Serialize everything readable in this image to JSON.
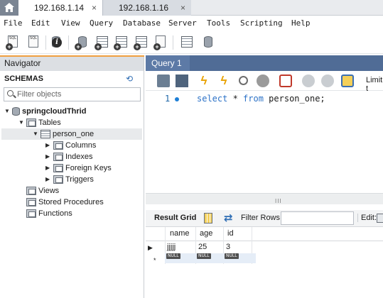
{
  "connection_tabs": [
    {
      "label": "192.168.1.14",
      "close": "×"
    },
    {
      "label": "192.168.1.16",
      "close": "×"
    }
  ],
  "menu": [
    "File",
    "Edit",
    "View",
    "Query",
    "Database",
    "Server",
    "Tools",
    "Scripting",
    "Help"
  ],
  "toolbar": {
    "new_sql_tab_label": "SQL",
    "open_sql_label": "SQL"
  },
  "navigator": {
    "header": "Navigator",
    "schemas_label": "SCHEMAS",
    "filter_placeholder": "Filter objects",
    "tree": {
      "schema": "springcloudThrid",
      "tables": "Tables",
      "table": "person_one",
      "table_children": [
        "Columns",
        "Indexes",
        "Foreign Keys",
        "Triggers"
      ],
      "views": "Views",
      "stored_procedures": "Stored Procedures",
      "functions": "Functions"
    }
  },
  "query_tab": {
    "label": "Query 1"
  },
  "query_toolbar": {
    "limit_label": "Limit t"
  },
  "editor": {
    "line_number": "1",
    "tokens": [
      {
        "text": "select",
        "kind": "kw"
      },
      {
        "text": " * ",
        "kind": "tx"
      },
      {
        "text": "from",
        "kind": "kw"
      },
      {
        "text": " person_one;",
        "kind": "tx"
      }
    ]
  },
  "scrollbar": {
    "thumb": "III"
  },
  "result_toolbar": {
    "result_grid_label": "Result Grid",
    "filter_rows_label": "Filter Rows:",
    "edit_label": "Edit:"
  },
  "result_grid": {
    "columns": [
      "name",
      "age",
      "id"
    ],
    "rows": [
      {
        "marker": "▶",
        "cells": [
          "jjjjj",
          "25",
          "3"
        ]
      },
      {
        "marker": "*",
        "cells": [
          "NULL",
          "NULL",
          "NULL"
        ]
      }
    ]
  },
  "colors": {
    "navigator_header": "#dcdfe3",
    "query_tab_bar": "#506c96",
    "keyword": "#2c72c7"
  }
}
